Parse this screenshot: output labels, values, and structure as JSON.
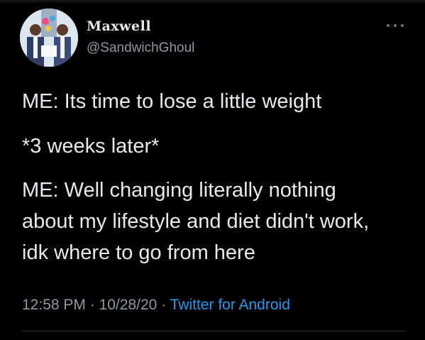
{
  "tweet": {
    "author": {
      "display_name": "Maxwell",
      "handle": "@SandwichGhoul"
    },
    "lines": [
      "ME: Its time to lose a little weight",
      "*3 weeks later*",
      "ME: Well changing literally nothing",
      "about my lifestyle and diet didn't work,",
      "idk where to go from here"
    ],
    "meta": {
      "time": "12:58 PM",
      "separator": "·",
      "date": "10/28/20",
      "source": "Twitter for Android"
    }
  },
  "icons": {
    "more": "more-options-icon",
    "avatar": "profile-photo"
  },
  "colors": {
    "background": "#000000",
    "text": "#e7e9ea",
    "muted": "#8b98a5",
    "link": "#1d9bf0",
    "divider": "#2f3336"
  }
}
